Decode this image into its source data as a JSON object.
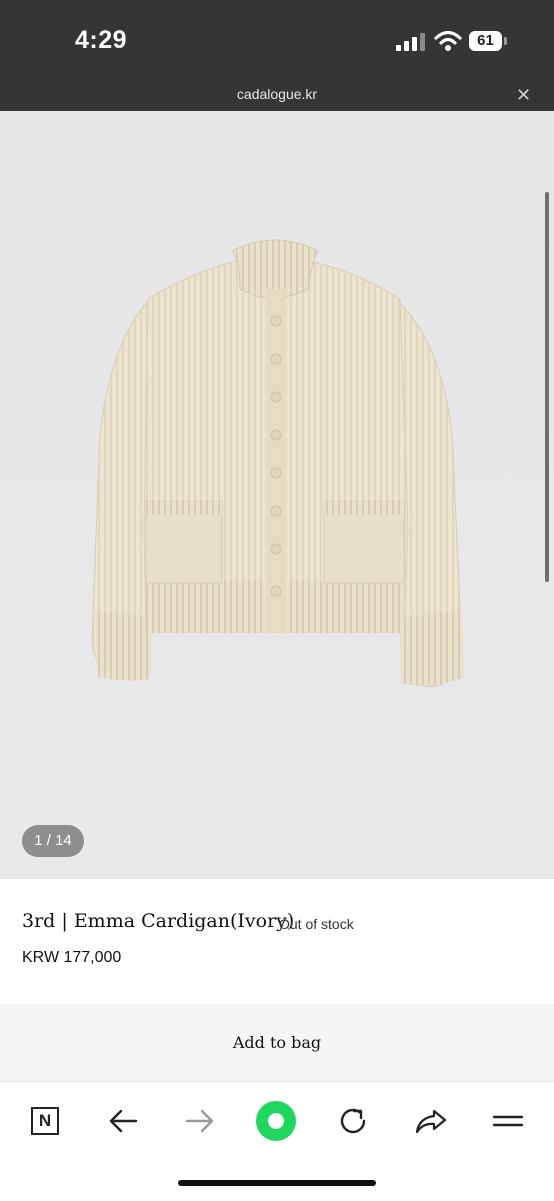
{
  "status_bar": {
    "time": "4:29",
    "battery_level": "61"
  },
  "browser": {
    "url": "cadalogue.kr",
    "close_icon": "close-icon"
  },
  "gallery": {
    "counter": "1 / 14",
    "image_subject": "ivory ribbed knit cardigan"
  },
  "product": {
    "title": "3rd | Emma Cardigan(Ivory)",
    "stock_status": "Out of stock",
    "price": "KRW 177,000"
  },
  "actions": {
    "add_to_bag": "Add to bag"
  },
  "toolbar": {
    "icons": [
      "naver-logo-icon",
      "back-arrow-icon",
      "forward-arrow-icon",
      "green-dot-icon",
      "reload-icon",
      "share-icon",
      "menu-icon"
    ]
  },
  "colors": {
    "status_bar_bg": "#353535",
    "accent_green": "#1fd65f",
    "cardigan_ivory": "#ece4cf"
  }
}
